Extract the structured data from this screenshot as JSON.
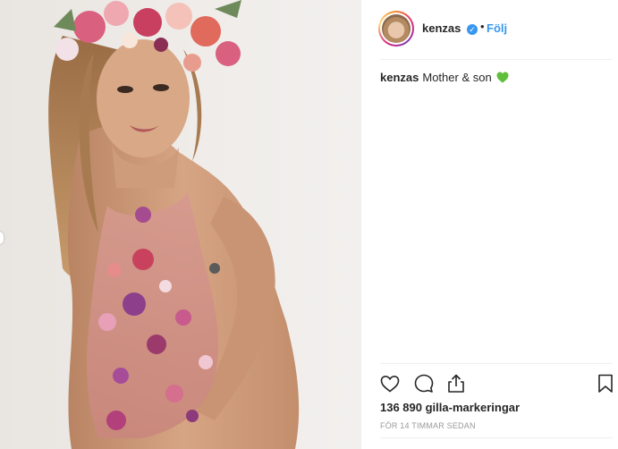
{
  "post": {
    "author": {
      "username": "kenzas",
      "verified": true,
      "separator": "•",
      "follow_label": "Följ"
    },
    "caption": {
      "username": "kenzas",
      "text": "Mother & son",
      "emoji": "green-heart-icon"
    },
    "actions": {
      "like_icon": "heart-icon",
      "comment_icon": "comment-icon",
      "share_icon": "share-icon",
      "save_icon": "bookmark-icon"
    },
    "likes": "136 890 gilla-markeringar",
    "timestamp": "FÖR 14 TIMMAR SEDAN"
  },
  "colors": {
    "link": "#3897f0",
    "text": "#262626",
    "muted": "#999999",
    "verified": "#3897f0",
    "emoji_heart": "#5fbf3a"
  }
}
